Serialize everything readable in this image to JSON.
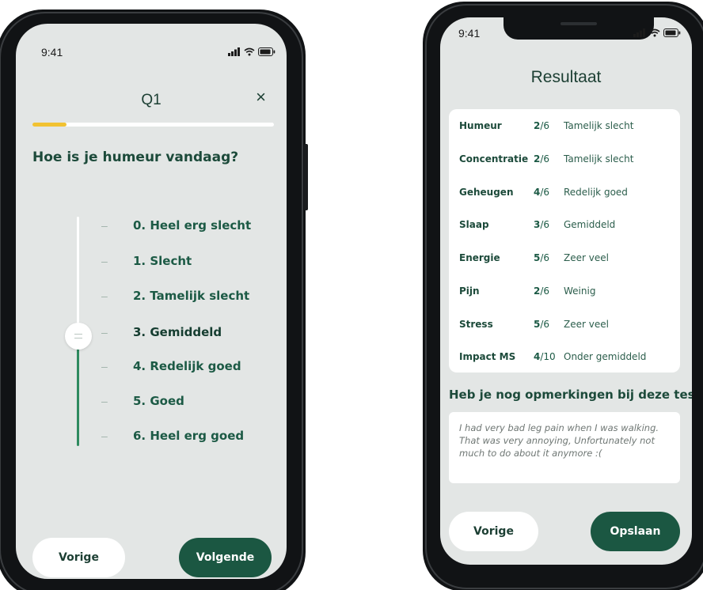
{
  "phone1": {
    "status_time": "9:41",
    "title": "Q1",
    "close_glyph": "×",
    "progress": 0.14,
    "question": "Hoe is je humeur vandaag?",
    "options": [
      "0. Heel erg slecht",
      "1. Slecht",
      "2. Tamelijk slecht",
      "3. Gemiddeld",
      "4. Redelijk goed",
      "5. Goed",
      "6. Heel erg goed"
    ],
    "selected_index": 3,
    "prev_label": "Vorige",
    "next_label": "Volgende",
    "colors": {
      "accent": "#1b5742",
      "progress": "#f1c232",
      "track_fill": "#2e8a5f"
    }
  },
  "phone2": {
    "status_time": "9:41",
    "title": "Resultaat",
    "results": [
      {
        "category": "Humeur",
        "score": "2",
        "max": "/6",
        "desc": "Tamelijk slecht"
      },
      {
        "category": "Concentratie",
        "score": "2",
        "max": "/6",
        "desc": "Tamelijk slecht"
      },
      {
        "category": "Geheugen",
        "score": "4",
        "max": "/6",
        "desc": "Redelijk goed"
      },
      {
        "category": "Slaap",
        "score": "3",
        "max": "/6",
        "desc": "Gemiddeld"
      },
      {
        "category": "Energie",
        "score": "5",
        "max": "/6",
        "desc": "Zeer veel"
      },
      {
        "category": "Pijn",
        "score": "2",
        "max": "/6",
        "desc": "Weinig"
      },
      {
        "category": "Stress",
        "score": "5",
        "max": "/6",
        "desc": "Zeer veel"
      },
      {
        "category": "Impact MS",
        "score": "4",
        "max": "/10",
        "desc": "Onder gemiddeld"
      }
    ],
    "comment_question": "Heb je nog opmerkingen bij deze test?",
    "comment_text": "I had very bad leg pain when I was walking. That was very annoying, Unfortunately not much to do about it anymore :(",
    "prev_label": "Vorige",
    "save_label": "Opslaan"
  }
}
